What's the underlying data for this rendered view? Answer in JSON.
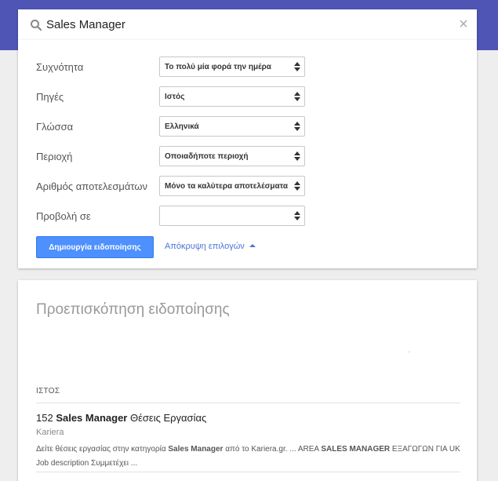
{
  "search": {
    "value": "Sales Manager",
    "placeholder": ""
  },
  "options": [
    {
      "label": "Συχνότητα",
      "value": "Το πολύ μία φορά την ημέρα"
    },
    {
      "label": "Πηγές",
      "value": "Ιστός"
    },
    {
      "label": "Γλώσσα",
      "value": "Ελληνικά"
    },
    {
      "label": "Περιοχή",
      "value": "Οποιαδήποτε περιοχή"
    },
    {
      "label": "Αριθμός αποτελεσμάτων",
      "value": "Μόνο τα καλύτερα αποτελέσματα"
    },
    {
      "label": "Προβολή σε",
      "value": ""
    }
  ],
  "actions": {
    "create_label": "Δημιουργία ειδοποίησης",
    "hide_options_label": "Απόκρυψη επιλογών"
  },
  "preview": {
    "title": "Προεπισκόπηση ειδοποίησης",
    "section_label": "ΙΣΤΟΣ",
    "result": {
      "title_prefix": "152 ",
      "title_bold": "Sales Manager",
      "title_suffix": " Θέσεις Εργασίας",
      "source": "Kariera",
      "snippet_1": "Δείτε θέσεις εργασίας στην κατηγορία ",
      "snippet_2": "Sales Manager",
      "snippet_3": " από το Kariera.gr. ... AREA ",
      "snippet_4": "SALES MANAGER",
      "snippet_5": " ΕΞΑΓΩΓΩΝ ΓΙΑ UK Job description Συμμετέχει ..."
    }
  },
  "colors": {
    "header": "#4f55b5",
    "button": "#4d90fe",
    "link": "#4d72d9"
  }
}
